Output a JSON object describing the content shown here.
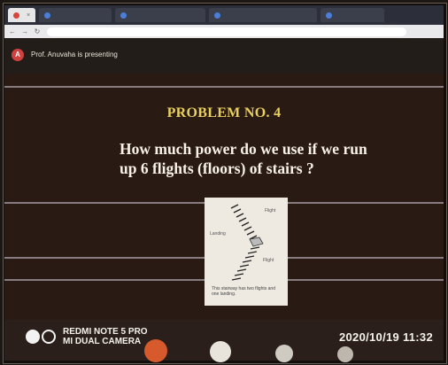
{
  "browser": {
    "tabs": [
      "",
      "",
      "",
      "",
      ""
    ],
    "address": ""
  },
  "meeting": {
    "presenter_initial": "A",
    "presenter_text": "Prof. Anuvaha is presenting"
  },
  "slide": {
    "title": "PROBLEM NO. 4",
    "question": "How much power do we use if we run up 6 flights (floors) of stairs ?",
    "figure": {
      "label_flight_top": "Flight",
      "label_landing": "Landing",
      "label_flight_bottom": "Flight",
      "caption": "This stairway has two flights and one landing."
    }
  },
  "photo_overlay": {
    "watermark_line1": "REDMI NOTE 5 PRO",
    "watermark_line2": "MI DUAL CAMERA",
    "timestamp": "2020/10/19  11:32"
  },
  "colors": {
    "title": "#e8d060",
    "question": "#f7f1e8",
    "slide_bg": "#2a1a14",
    "avatar": "#d0413d"
  }
}
